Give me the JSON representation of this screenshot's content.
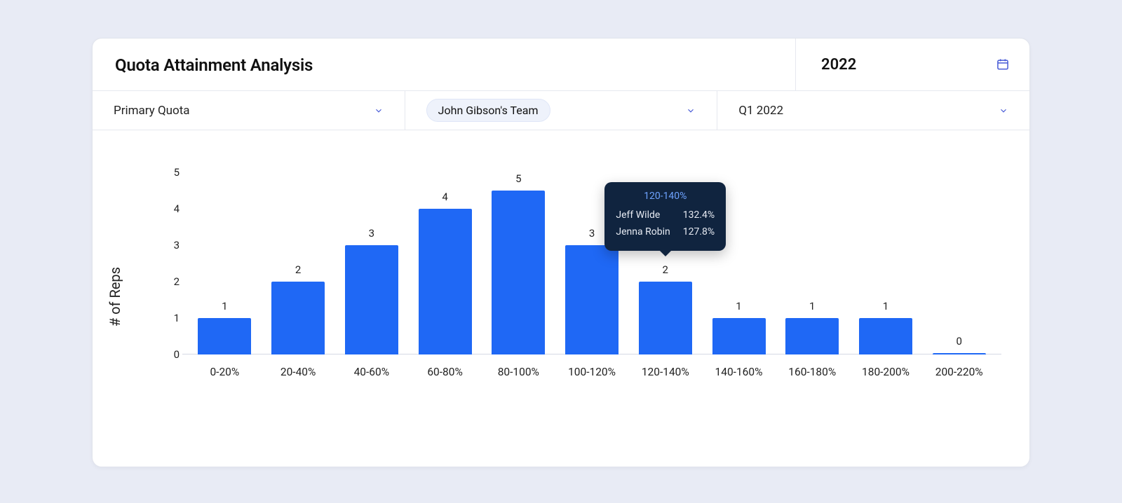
{
  "title": "Quota Attainment Analysis",
  "year": "2022",
  "filters": {
    "quota": {
      "label": "Primary Quota"
    },
    "team": {
      "label": "John Gibson's Team"
    },
    "period": {
      "label": "Q1  2022"
    }
  },
  "chart_data": {
    "type": "bar",
    "title": "Quota Attainment Analysis",
    "xlabel": "",
    "ylabel": "# of Reps",
    "ylim": [
      0,
      5
    ],
    "yticks": [
      0,
      1,
      2,
      3,
      4,
      5
    ],
    "categories": [
      "0-20%",
      "20-40%",
      "40-60%",
      "60-80%",
      "80-100%",
      "100-120%",
      "120-140%",
      "140-160%",
      "160-180%",
      "180-200%",
      "200-220%"
    ],
    "values": [
      1,
      2,
      3,
      4,
      5,
      3,
      2,
      1,
      1,
      1,
      0
    ]
  },
  "tooltip": {
    "bucket": "120-140%",
    "rows": [
      {
        "name": "Jeff Wilde",
        "value": "132.4%"
      },
      {
        "name": "Jenna Robin",
        "value": "127.8%"
      }
    ]
  },
  "colors": {
    "bar": "#1f68f5",
    "tooltip_bg": "#10243f",
    "tooltip_title": "#6ea3ff"
  }
}
